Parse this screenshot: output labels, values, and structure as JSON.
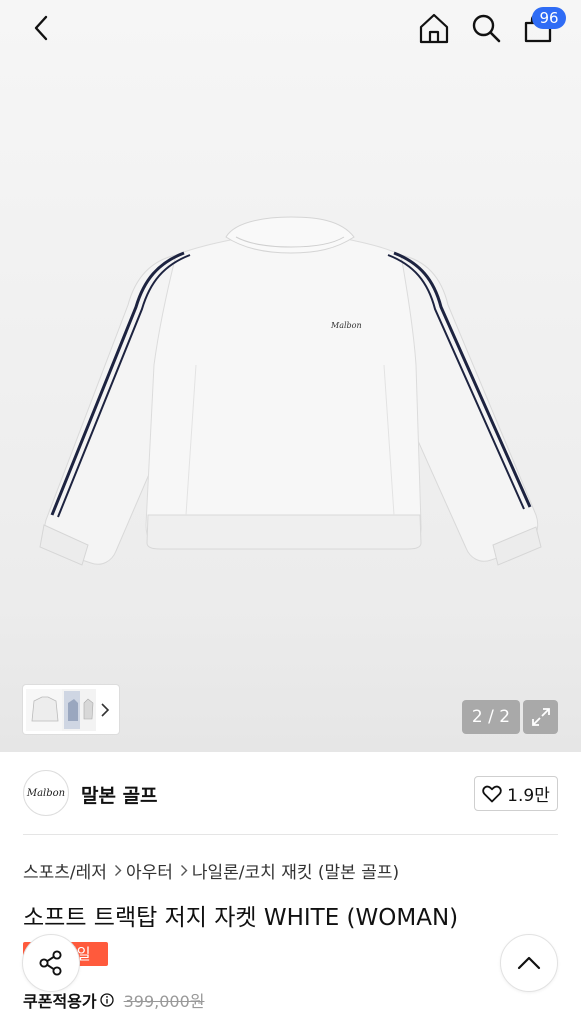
{
  "header": {
    "cart_count": "96",
    "icons": [
      "chevron-left-icon",
      "home-icon",
      "search-icon",
      "shopping-bag-icon"
    ]
  },
  "gallery": {
    "counter": "2 / 2",
    "product_logo_text": "Malbon",
    "icons": [
      "chevron-right-icon",
      "expand-icon"
    ]
  },
  "brand": {
    "logo_text": "Malbon",
    "name": "말본 골프",
    "like_count": "1.9만"
  },
  "breadcrumb": [
    "스포츠/레저",
    "아우터",
    "나일론/코치 재킷 (말본 골프)"
  ],
  "product": {
    "title": "소프트 트랙탑 저지 자켓 WHITE (WOMAN)",
    "sale_badge": "세일"
  },
  "price": {
    "label": "쿠폰적용가",
    "original": "399,000원"
  },
  "colors": {
    "badge_blue": "#2f6cf5",
    "sale_orange": "#ff5a3c",
    "counter_gray": "#a9a9a9"
  }
}
